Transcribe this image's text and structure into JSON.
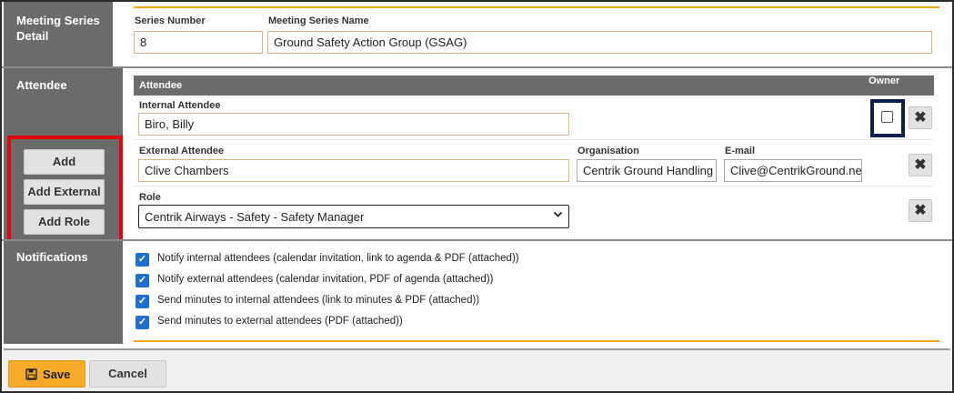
{
  "sections": {
    "detail_title": "Meeting Series Detail",
    "attendee_title": "Attendee",
    "notifications_title": "Notifications"
  },
  "detail": {
    "series_number_label": "Series Number",
    "series_number_value": "8",
    "series_name_label": "Meeting Series Name",
    "series_name_value": "Ground Safety Action Group (GSAG)"
  },
  "attendee_table": {
    "header_attendee": "Attendee",
    "header_owner": "Owner",
    "internal_label": "Internal Attendee",
    "internal_value": "Biro, Billy",
    "external_label": "External Attendee",
    "external_value": "Clive Chambers",
    "organisation_label": "Organisation",
    "organisation_value": "Centrik Ground Handling",
    "email_label": "E-mail",
    "email_value": "Clive@CentrikGround.net",
    "role_label": "Role",
    "role_value": "Centrik Airways - Safety - Safety Manager",
    "remove_glyph": "✖"
  },
  "side_buttons": {
    "add": "Add",
    "add_external": "Add External",
    "add_role": "Add Role"
  },
  "notifications": [
    {
      "label": "Notify internal attendees (calendar invitation, link to agenda & PDF (attached))",
      "checked": true
    },
    {
      "label": "Notify external attendees (calendar invitation, PDF of agenda (attached))",
      "checked": true
    },
    {
      "label": "Send minutes to internal attendees (link to minutes & PDF (attached))",
      "checked": true
    },
    {
      "label": "Send minutes to external attendees (PDF (attached))",
      "checked": true
    }
  ],
  "footer": {
    "save_label": "Save",
    "cancel_label": "Cancel"
  },
  "colors": {
    "sidebar_bg": "#6b6b6b",
    "accent_gold": "#f3a712",
    "checkbox_blue": "#1e6fd1",
    "highlight_red": "#e8000b",
    "highlight_navy": "#0d1f4a"
  }
}
